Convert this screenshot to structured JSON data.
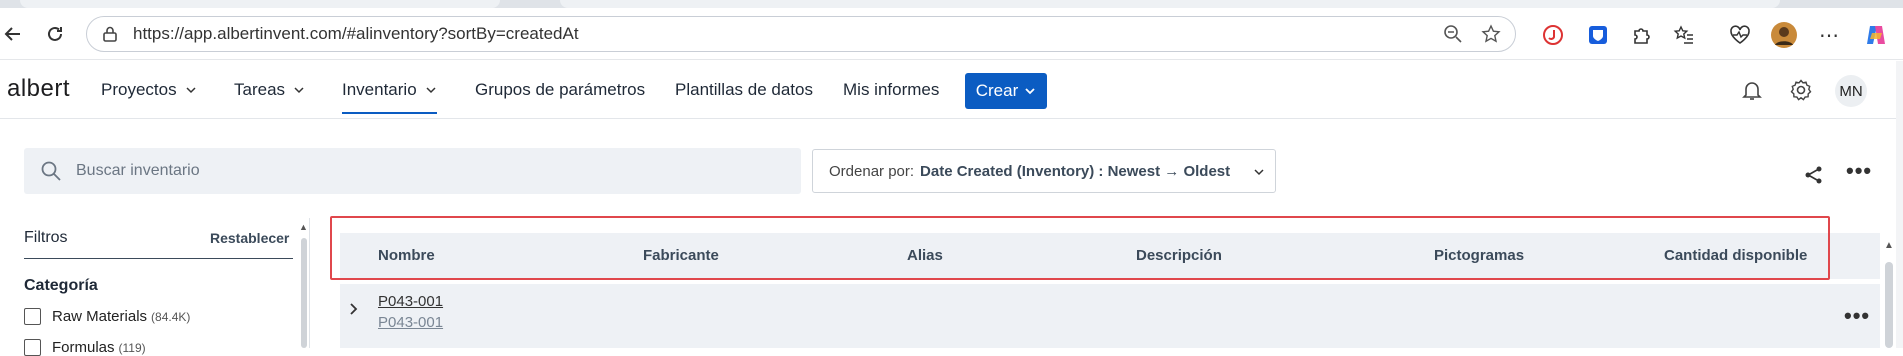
{
  "browser": {
    "url": "https://app.albertinvent.com/#alinventory?sortBy=createdAt"
  },
  "app": {
    "logo": "albert",
    "nav": [
      {
        "label": "Proyectos",
        "has_dropdown": true
      },
      {
        "label": "Tareas",
        "has_dropdown": true
      },
      {
        "label": "Inventario",
        "has_dropdown": true,
        "active": true
      },
      {
        "label": "Grupos de parámetros"
      },
      {
        "label": "Plantillas de datos"
      },
      {
        "label": "Mis informes"
      }
    ],
    "create_label": "Crear",
    "avatar_initials": "MN",
    "accent_color": "#0b5cc2"
  },
  "search": {
    "placeholder": "Buscar inventario",
    "value": ""
  },
  "sort": {
    "label": "Ordenar por:",
    "value": "Date Created (Inventory) : Newest → Oldest"
  },
  "filters": {
    "title": "Filtros",
    "reset_label": "Restablecer",
    "category_title": "Categoría",
    "items": [
      {
        "label": "Raw Materials",
        "count": "(84.4K)",
        "checked": false
      },
      {
        "label": "Formulas",
        "count": "(119)",
        "checked": false
      }
    ]
  },
  "table": {
    "columns": [
      "Nombre",
      "Fabricante",
      "Alias",
      "Descripción",
      "Pictogramas",
      "Cantidad disponible"
    ],
    "rows": [
      {
        "name": "P043-001",
        "sub_name": "P043-001"
      }
    ],
    "highlight_color": "#e0474c"
  }
}
